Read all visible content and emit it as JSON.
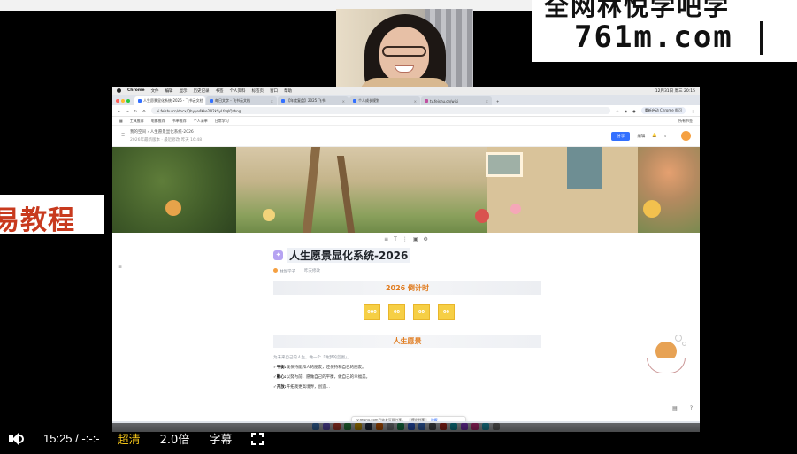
{
  "watermark": {
    "line1": "全网林悦学吧学",
    "line2": "761m.com"
  },
  "side_tag": "易教程",
  "mac_menu": {
    "app": "Chrome",
    "items": [
      "文件",
      "编辑",
      "显示",
      "历史记录",
      "书签",
      "个人资料",
      "标签页",
      "窗口",
      "帮助"
    ],
    "clock": "12月31日 周三 20:15"
  },
  "tabs": [
    {
      "label": "人生愿景显化系统-2026 - 飞书云文档",
      "active": true
    },
    {
      "label": "每日文字 - 飞书云文档",
      "active": false
    },
    {
      "label": "【年度复盘】2025 飞书",
      "active": false
    },
    {
      "label": "个人成长规划",
      "active": false
    },
    {
      "label": "tv.feishu.cn/wiki",
      "active": false
    }
  ],
  "address": {
    "url": "ai.feishu.cn/docx/Qhyye4Kke2N2kSyLfcqIQzhng",
    "button": "重新启动 Chrome 即可"
  },
  "bookmarks": [
    "工具推荐",
    "电影推荐",
    "书单推荐",
    "个人清单",
    "日常学习"
  ],
  "bookmarks_right": "所有书签",
  "doc_header": {
    "crumb": "我的空间",
    "doc": "人生愿景显化系统-2026",
    "sub": "2026年最新版本 · 最近修改 昨天 16:48",
    "share": "分享",
    "edit": "编辑"
  },
  "doc": {
    "title": "人生愿景显化系统-2026",
    "author": "林悦学子",
    "updated": "昨天修改",
    "countdown_title": "2026 倒计时",
    "countdown": [
      "000",
      "00",
      "00",
      "00"
    ],
    "section_title": "人生愿景",
    "intro": "为未来自己的人生，做一个「做梦的蓝图」。",
    "items": [
      {
        "key": "平衡:",
        "text": "既保持能和人的朋友，还保持和自己的朋友。"
      },
      {
        "key": "勤心:",
        "text": "以努为前，愿做自己的平衡，做自己的幸福美。"
      },
      {
        "key": "开放:",
        "text": "开拓我更高境界，创造..."
      }
    ]
  },
  "toast": {
    "text": "tv.feishu.com已恢复页面分享。",
    "stop": "停止共享",
    "hide": "隐藏"
  },
  "player": {
    "time": "15:25",
    "sep": "/",
    "duration": "-:-:-",
    "quality": "超清",
    "speed": "2.0倍",
    "subtitle": "字幕"
  }
}
